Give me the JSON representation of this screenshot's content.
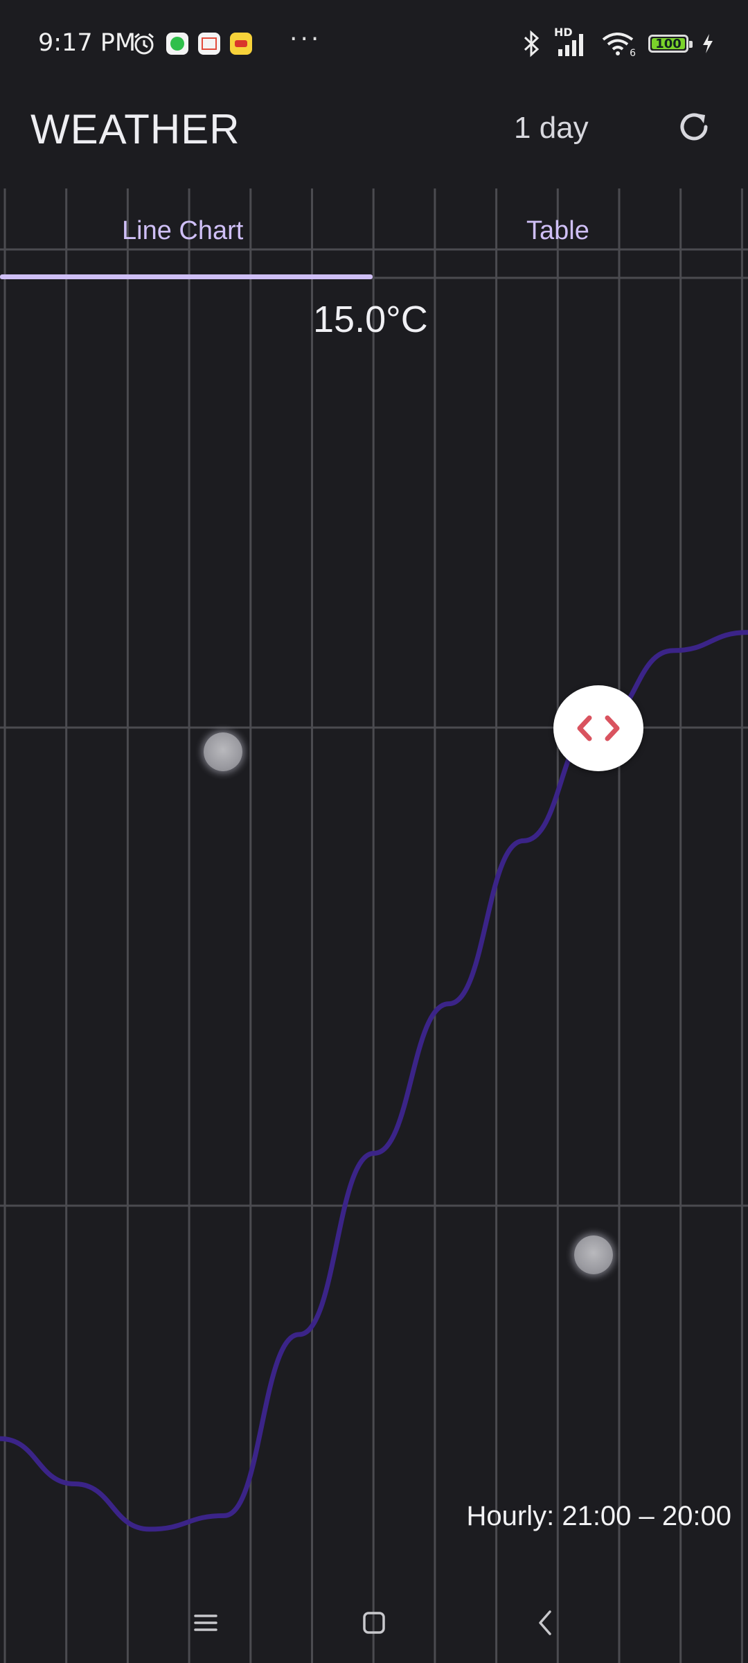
{
  "status_bar": {
    "time": "9:17 PM",
    "icons_left": [
      "alarm-icon",
      "green-app-icon",
      "shop-app-icon",
      "yellow-app-icon",
      "more-dots-icon"
    ],
    "more": "···",
    "icons_right": [
      "bluetooth-icon",
      "cell-signal-icon",
      "wifi-icon",
      "battery-icon",
      "charging-icon"
    ],
    "signal_label": "HD",
    "wifi_label": "6",
    "battery_level": "100"
  },
  "header": {
    "title": "WEATHER",
    "range_label": "1 day",
    "refresh_icon": "refresh-icon"
  },
  "tabs": [
    {
      "label": "Line Chart",
      "selected": true
    },
    {
      "label": "Table",
      "selected": false
    }
  ],
  "readout": {
    "value": "15.0°C"
  },
  "chart_data": {
    "type": "line",
    "series": [
      {
        "values": [
          6.2,
          5.2,
          4.2,
          4.5,
          8.5,
          12.5,
          15.8,
          19.4,
          22.0,
          23.6,
          24.0
        ]
      }
    ],
    "selected_value": "15.0°C",
    "grid": true,
    "line_color": "#3b2488",
    "x_range_label": "Hourly: 21:00 – 20:00"
  },
  "scroll_handle": {
    "icon": "left-right-chevrons-icon",
    "color": "#d9535f"
  },
  "footer": {
    "hourly_range": "Hourly: 21:00 – 20:00"
  },
  "nav_bar": {
    "icons": [
      "menu-icon",
      "home-icon",
      "back-icon"
    ]
  },
  "colors": {
    "background": "#1c1c20",
    "accent": "#cfbff6",
    "grid": "#4b4b50"
  }
}
